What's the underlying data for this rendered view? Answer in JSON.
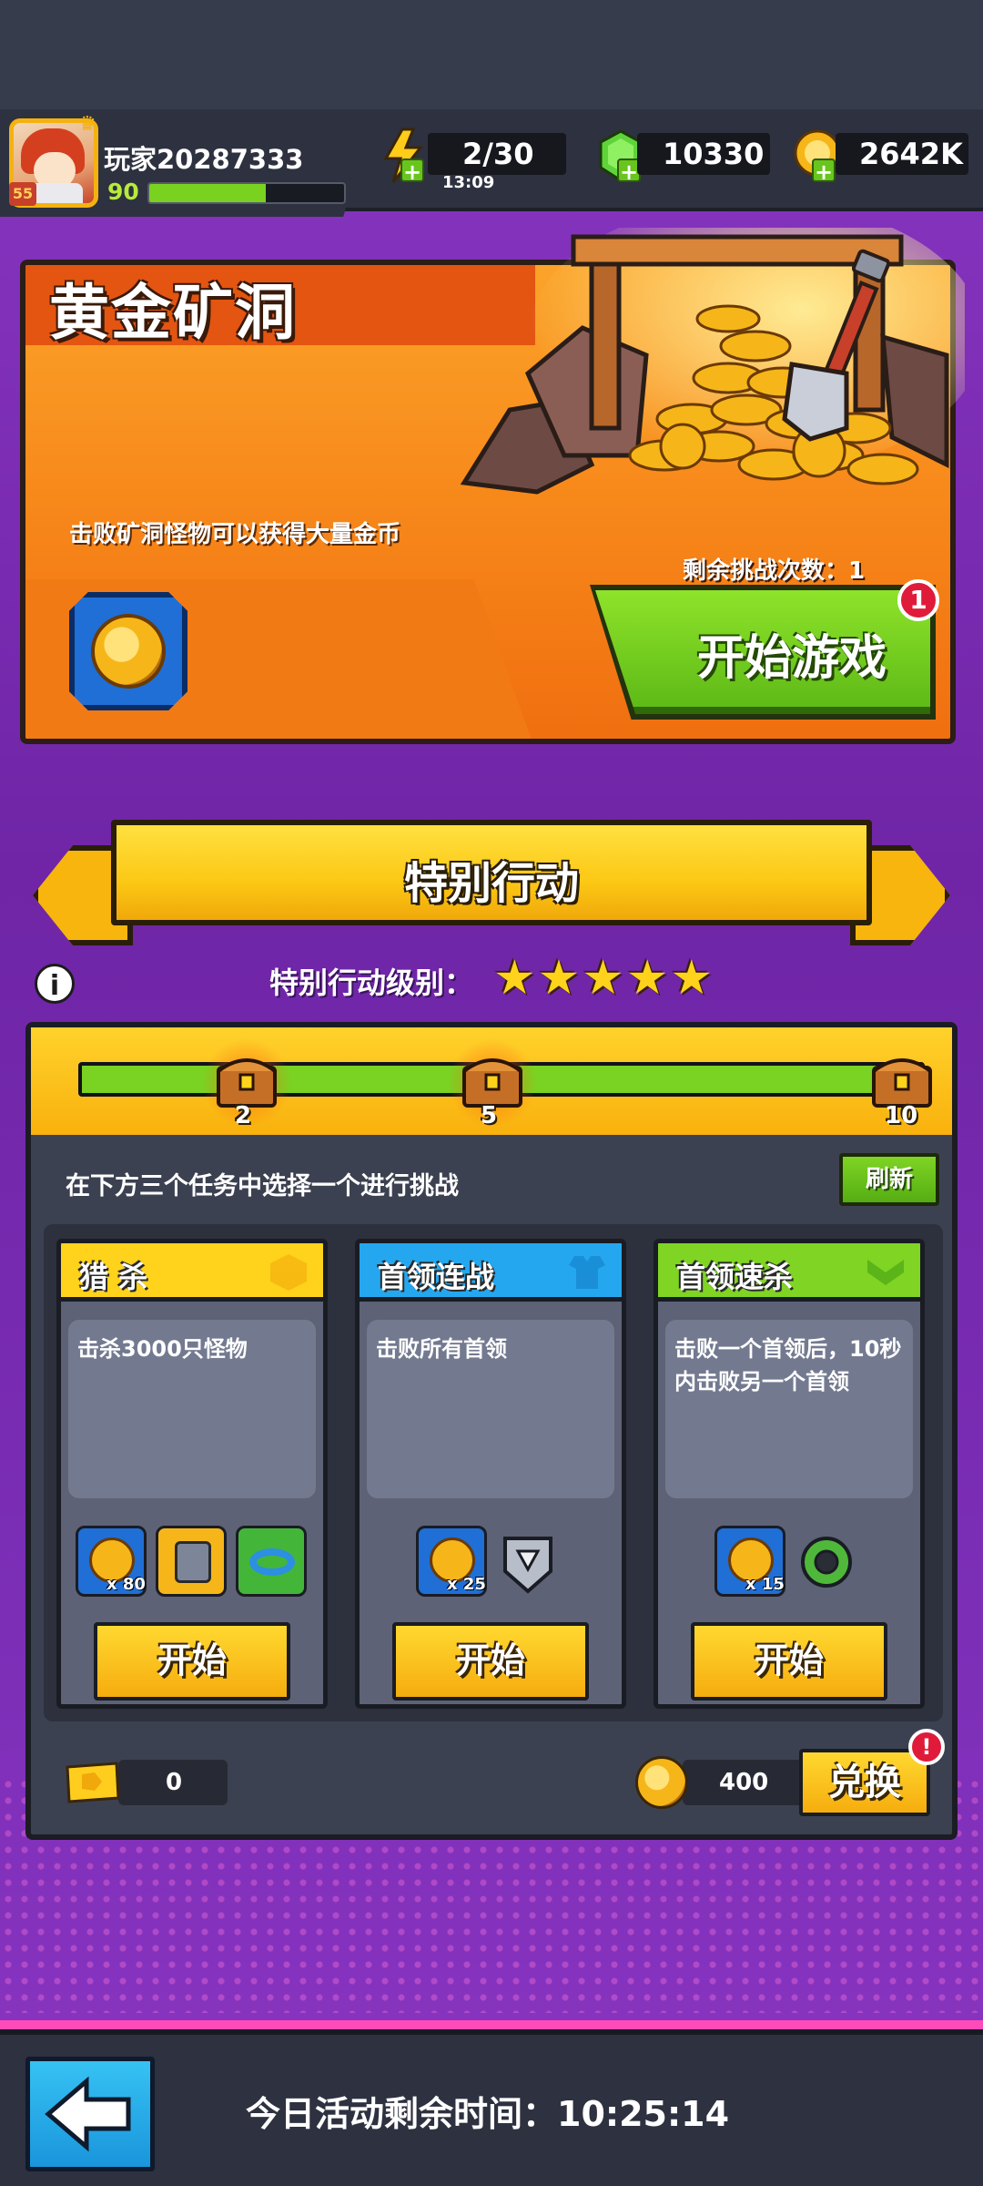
{
  "header": {
    "player_name": "玩家20287333",
    "player_level": "55",
    "xp_level": "90",
    "xp_progress": 0.6,
    "energy": "2/30",
    "energy_timer": "13:09",
    "gems": "10330",
    "coins": "2642K"
  },
  "event_card": {
    "title": "黄金矿洞",
    "description": "击败矿洞怪物可以获得大量金币",
    "remaining_label": "剩余挑战次数：1",
    "start_button": "开始游戏",
    "start_badge": "1"
  },
  "special_action": {
    "title": "特别行动",
    "level_label": "特别行动级别：",
    "stars": "★★★★★",
    "info_icon": "i",
    "progress": 0.95,
    "milestones": [
      "2",
      "5",
      "10"
    ],
    "choose_text": "在下方三个任务中选择一个进行挑战",
    "refresh_label": "刷新",
    "tasks": [
      {
        "title": "猎 杀",
        "description": "击杀3000只怪物",
        "reward_count": "x 80",
        "start_label": "开始",
        "head_color": "#ffd21b"
      },
      {
        "title": "首领连战",
        "description": "击败所有首领",
        "reward_count": "x 25",
        "start_label": "开始",
        "head_color": "#25a7ef"
      },
      {
        "title": "首领速杀",
        "description": "击败一个首领后，10秒内击败另一个首领",
        "reward_count": "x 15",
        "start_label": "开始",
        "head_color": "#7fd424"
      }
    ],
    "ticket_count": "0",
    "coin_cost": "400",
    "exchange_label": "兑换",
    "exchange_badge": "!"
  },
  "footer": {
    "timer_text": "今日活动剩余时间：10:25:14",
    "back_icon": "back-arrow-icon"
  },
  "colors": {
    "background": "#7a2cae",
    "accent_orange": "#f7881a",
    "accent_green": "#7ad222",
    "accent_yellow": "#ffd21b",
    "panel": "#3c4151"
  }
}
